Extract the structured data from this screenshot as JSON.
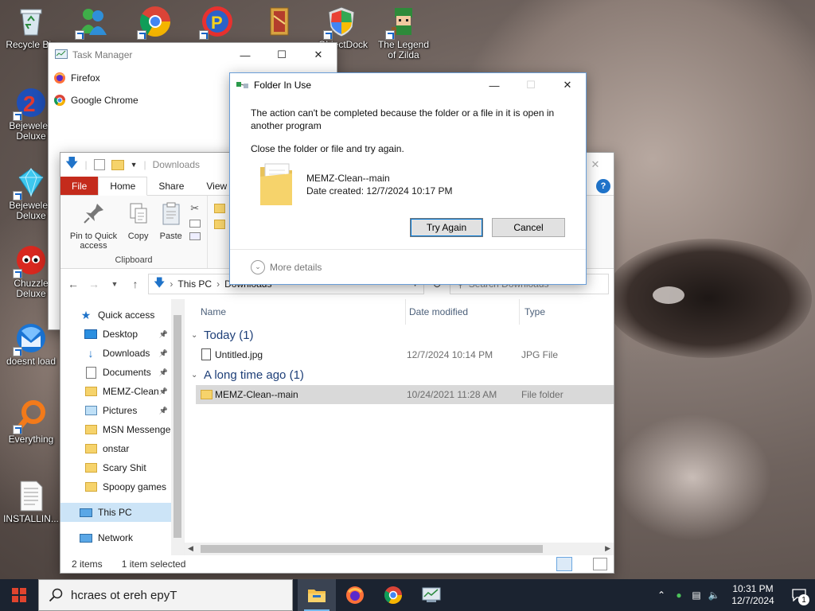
{
  "desktop": {
    "icons": [
      {
        "label": "Recycle Bin",
        "icon": "recycle-bin-icon"
      },
      {
        "label": "",
        "icon": "msn-messenger-icon"
      },
      {
        "label": "",
        "icon": "chrome-icon"
      },
      {
        "label": "",
        "icon": "pac-man-icon"
      },
      {
        "label": "",
        "icon": "folder-book-icon"
      },
      {
        "label": "ObjectDock",
        "icon": "shield-icon"
      },
      {
        "label": "The Legend of Zilda",
        "icon": "zelda-icon"
      },
      {
        "label": "Bejeweled Deluxe",
        "icon": "bejeweled2-icon"
      },
      {
        "label": "Bejeweled Deluxe",
        "icon": "bejeweled-icon"
      },
      {
        "label": "Chuzzle Deluxe",
        "icon": "chuzzle-icon"
      },
      {
        "label": "doesnt load",
        "icon": "thunderbird-icon"
      },
      {
        "label": "Everything",
        "icon": "everything-icon"
      },
      {
        "label": "INSTALLIN...",
        "icon": "text-file-icon"
      }
    ]
  },
  "task_manager": {
    "title": "Task Manager",
    "apps": [
      {
        "label": "Firefox",
        "icon": "firefox-icon"
      },
      {
        "label": "Google Chrome",
        "icon": "chrome-icon"
      }
    ]
  },
  "explorer": {
    "qat_title": "Downloads",
    "tabs": [
      "File",
      "Home",
      "Share",
      "View"
    ],
    "ribbon": {
      "pin_label": "Pin to Quick access",
      "copy_label": "Copy",
      "paste_label": "Paste",
      "group_label": "Clipboard"
    },
    "breadcrumb": [
      "This PC",
      "Downloads"
    ],
    "search_placeholder": "Search Downloads",
    "nav": [
      {
        "label": "Quick access",
        "icon": "star-icon",
        "pinned": false,
        "indent": 0
      },
      {
        "label": "Desktop",
        "icon": "desktop-icon",
        "pinned": true,
        "indent": 1
      },
      {
        "label": "Downloads",
        "icon": "download-arrow-icon",
        "pinned": true,
        "indent": 1
      },
      {
        "label": "Documents",
        "icon": "documents-icon",
        "pinned": true,
        "indent": 1
      },
      {
        "label": "MEMZ-Clean",
        "icon": "folder-icon",
        "pinned": true,
        "indent": 1
      },
      {
        "label": "Pictures",
        "icon": "pictures-icon",
        "pinned": true,
        "indent": 1
      },
      {
        "label": "MSN Messenger",
        "icon": "folder-icon",
        "pinned": false,
        "indent": 1
      },
      {
        "label": "onstar",
        "icon": "folder-icon",
        "pinned": false,
        "indent": 1
      },
      {
        "label": "Scary Shit",
        "icon": "folder-icon",
        "pinned": false,
        "indent": 1
      },
      {
        "label": "Spoopy games",
        "icon": "folder-icon",
        "pinned": false,
        "indent": 1
      },
      {
        "label": "This PC",
        "icon": "computer-icon",
        "pinned": false,
        "indent": 0,
        "selected": true
      },
      {
        "label": "Network",
        "icon": "network-icon",
        "pinned": false,
        "indent": 0
      }
    ],
    "columns": {
      "name": "Name",
      "date": "Date modified",
      "type": "Type"
    },
    "groups": [
      {
        "header": "Today (1)",
        "files": [
          {
            "name": "Untitled.jpg",
            "date": "12/7/2024 10:14 PM",
            "type": "JPG File",
            "icon": "image-file-icon",
            "selected": false
          }
        ]
      },
      {
        "header": "A long time ago (1)",
        "files": [
          {
            "name": "MEMZ-Clean--main",
            "date": "10/24/2021 11:28 AM",
            "type": "File folder",
            "icon": "folder-icon",
            "selected": true
          }
        ]
      }
    ],
    "status": {
      "count": "2 items",
      "selection": "1 item selected"
    }
  },
  "dialog": {
    "title": "Folder In Use",
    "message": "The action can't be completed because the folder or a file in it is open in another program",
    "instruction": "Close the folder or file and try again.",
    "file_name": "MEMZ-Clean--main",
    "date_created": "Date created: 12/7/2024 10:17 PM",
    "try_again": "Try Again",
    "cancel": "Cancel",
    "more_details": "More details"
  },
  "taskbar": {
    "search_text": "hcraes ot ereh epyT",
    "apps": [
      "file-explorer-icon",
      "firefox-icon",
      "chrome-icon",
      "task-manager-icon"
    ],
    "time": "10:31 PM",
    "date": "12/7/2024",
    "notification_count": "1"
  },
  "colors": {
    "file_tab": "#c42b1c",
    "accent": "#0078d7",
    "taskbar": "#1b2330",
    "selection": "#cce4f7"
  }
}
